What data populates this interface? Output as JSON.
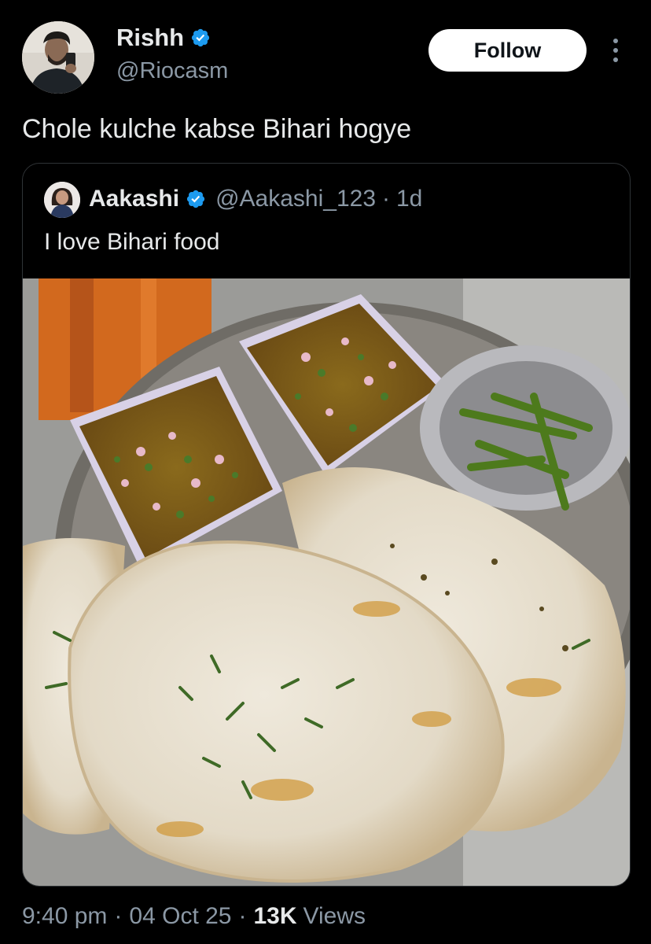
{
  "author": {
    "display_name": "Rishh",
    "handle": "@Riocasm",
    "verified_icon": "verified-badge-icon",
    "verified_color": "#1d9bf0"
  },
  "follow_button": {
    "label": "Follow"
  },
  "more_menu": {
    "icon": "more-vertical-icon"
  },
  "tweet": {
    "text": "Chole kulche kabse Bihari hogye"
  },
  "quoted_tweet": {
    "display_name": "Aakashi",
    "handle": "@Aakashi_123",
    "separator": "·",
    "time": "1d",
    "text": "I love Bihari food",
    "media": "food-photo-chole-kulche"
  },
  "meta": {
    "time": "9:40 pm",
    "date": "04 Oct 25",
    "separator": "·",
    "views_count": "13K",
    "views_label": "Views"
  },
  "colors": {
    "background": "#000000",
    "text_primary": "#e7e9ea",
    "text_secondary": "#8b98a5",
    "border": "#2f3336",
    "button_bg": "#ffffff"
  }
}
